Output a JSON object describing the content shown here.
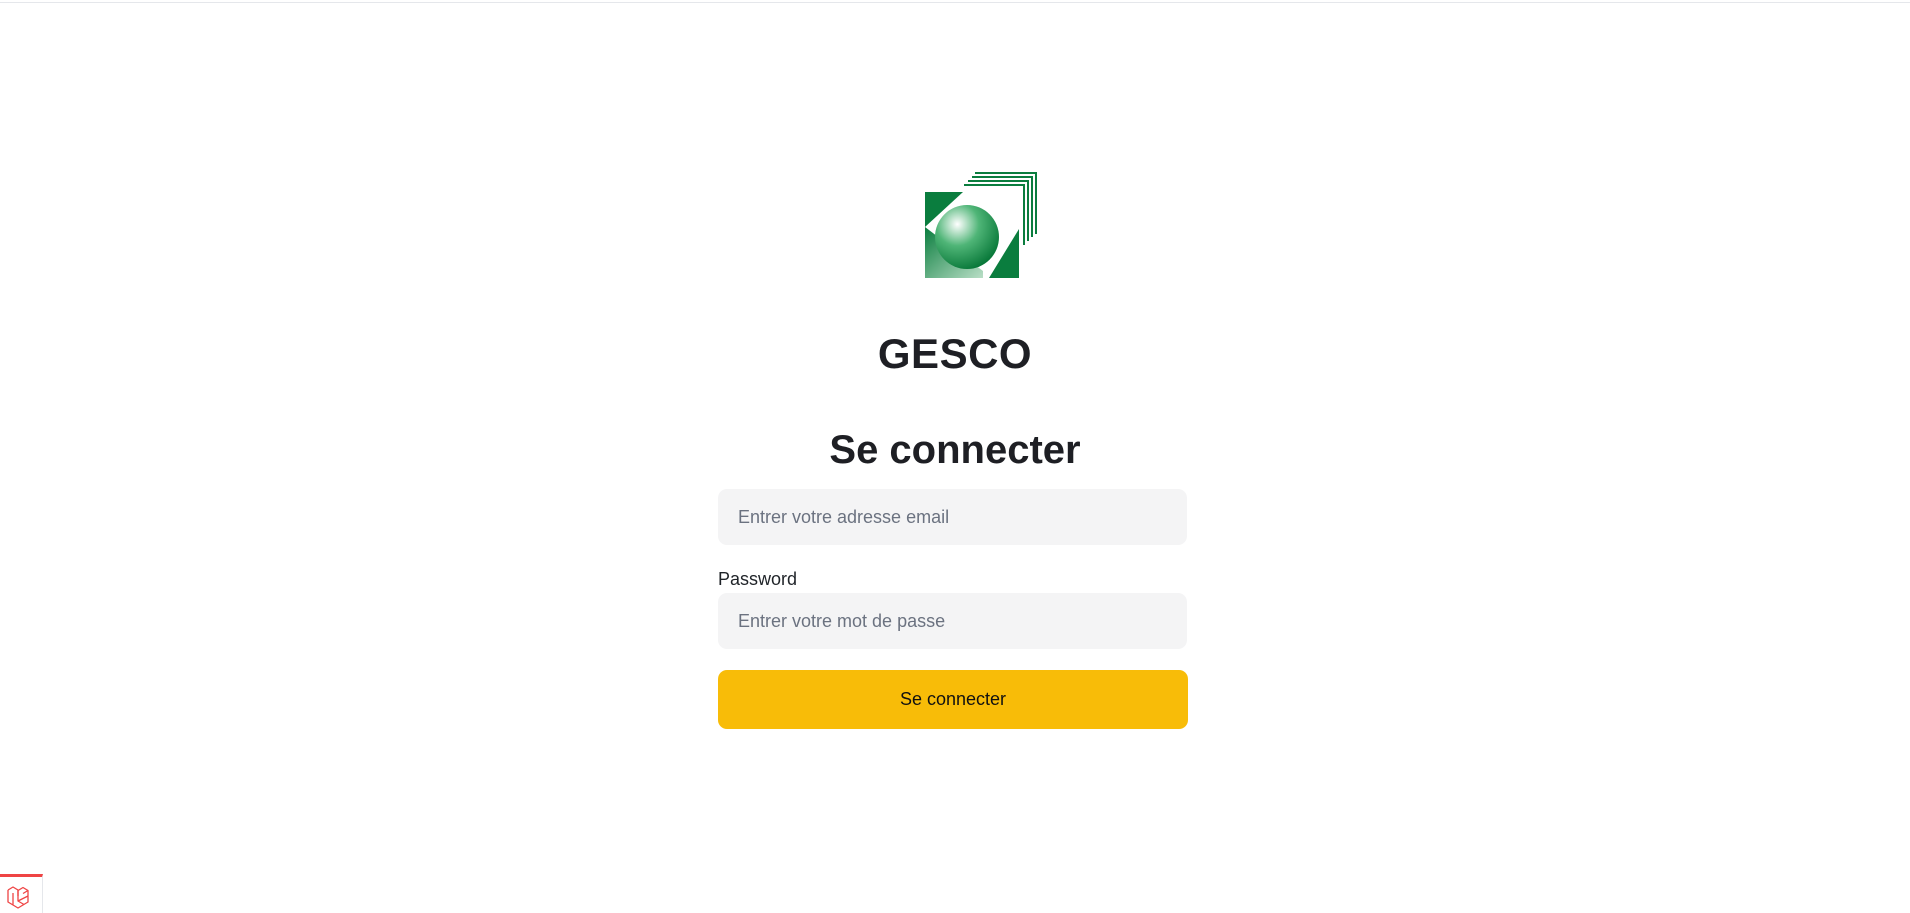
{
  "app": {
    "brand": "GESCO",
    "logo_icon": "gesco-logo-icon"
  },
  "login": {
    "title": "Se connecter",
    "email_placeholder": "Entrer votre adresse email",
    "email_value": "",
    "password_label": "Password",
    "password_placeholder": "Entrer votre mot de passe",
    "password_value": "",
    "submit_label": "Se connecter"
  },
  "debug": {
    "icon": "laravel-icon"
  },
  "colors": {
    "accent": "#f8bc08",
    "logo_green": "#0a7d3e",
    "input_bg": "#f4f4f5",
    "debug_red": "#ef4444"
  }
}
